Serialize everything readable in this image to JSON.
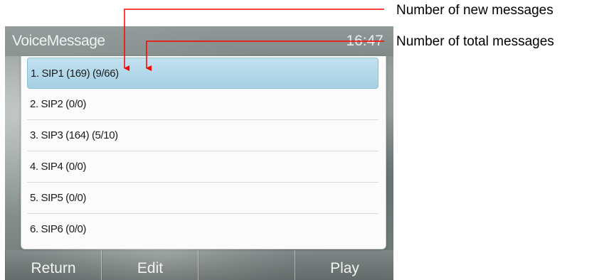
{
  "screen": {
    "title": "VoiceMessage",
    "clock": "16:47"
  },
  "accounts": [
    {
      "label": "1. SIP1 (169) (9/66)",
      "selected": true
    },
    {
      "label": "2. SIP2 (0/0)",
      "selected": false
    },
    {
      "label": "3. SIP3 (164) (5/10)",
      "selected": false
    },
    {
      "label": "4. SIP4 (0/0)",
      "selected": false
    },
    {
      "label": "5. SIP5 (0/0)",
      "selected": false
    },
    {
      "label": "6. SIP6 (0/0)",
      "selected": false
    }
  ],
  "softkeys": [
    "Return",
    "Edit",
    "",
    "Play"
  ],
  "annotations": {
    "new_messages": "Number of new messages",
    "total_messages": "Number of total messages"
  },
  "colors": {
    "callout": "#ff0000",
    "selection": "#a5d0e4"
  }
}
